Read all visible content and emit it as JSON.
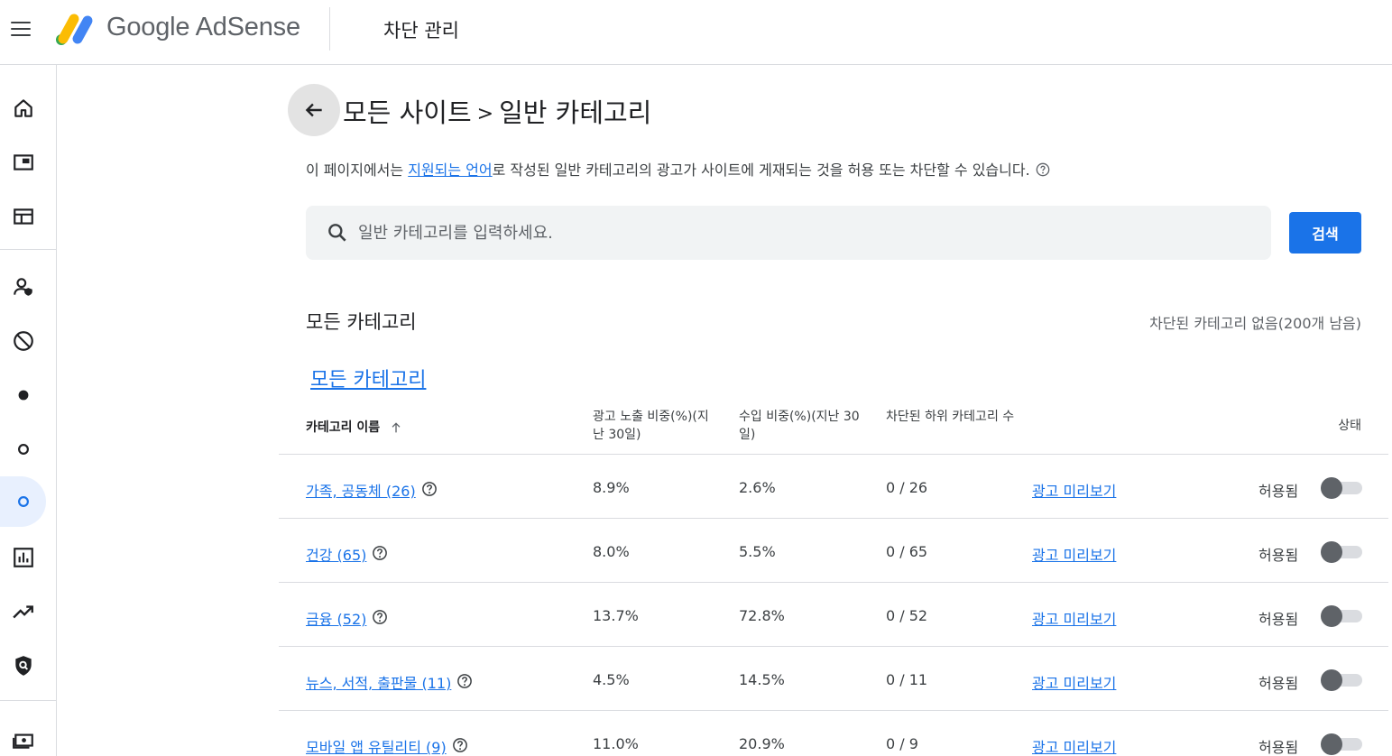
{
  "app": {
    "brand": "Google AdSense",
    "section": "차단 관리"
  },
  "page": {
    "breadcrumb_root": "모든 사이트",
    "breadcrumb_sep": ">",
    "breadcrumb_current": "일반 카테고리",
    "desc_pre": "이 페이지에서는 ",
    "desc_link": "지원되는 언어",
    "desc_post": "로 작성된 일반 카테고리의 광고가 사이트에 게재되는 것을 허용 또는 차단할 수 있습니다."
  },
  "search": {
    "placeholder": "일반 카테고리를 입력하세요.",
    "button": "검색"
  },
  "section": {
    "title": "모든 카테고리",
    "status": "차단된 카테고리 없음(200개 남음)",
    "link": "모든 카테고리"
  },
  "table": {
    "headers": {
      "name": "카테고리 이름",
      "impressions": "광고 노출 비중(%)(지난 30일)",
      "revenue": "수입 비중(%)(지난 30일)",
      "blocked": "차단된 하위 카테고리 수",
      "status": "상태"
    },
    "rows": [
      {
        "name": "가족, 공동체 (26)",
        "impressions": "8.9%",
        "revenue": "2.6%",
        "blocked": "0 / 26",
        "preview": "광고 미리보기",
        "status": "허용됨"
      },
      {
        "name": "건강 (65)",
        "impressions": "8.0%",
        "revenue": "5.5%",
        "blocked": "0 / 65",
        "preview": "광고 미리보기",
        "status": "허용됨"
      },
      {
        "name": "금융 (52)",
        "impressions": "13.7%",
        "revenue": "72.8%",
        "blocked": "0 / 52",
        "preview": "광고 미리보기",
        "status": "허용됨"
      },
      {
        "name": "뉴스, 서적, 출판물 (11)",
        "impressions": "4.5%",
        "revenue": "14.5%",
        "blocked": "0 / 11",
        "preview": "광고 미리보기",
        "status": "허용됨"
      },
      {
        "name": "모바일 앱 유틸리티 (9)",
        "impressions": "11.0%",
        "revenue": "20.9%",
        "blocked": "0 / 9",
        "preview": "광고 미리보기",
        "status": "허용됨"
      }
    ]
  },
  "sidebar": {
    "icons": [
      "home-icon",
      "ad-unit-icon",
      "sites-icon",
      "privacy-icon",
      "block-icon",
      "dot-filled-icon",
      "dot-outline-icon",
      "dot-outline-active-icon",
      "reports-icon",
      "optimization-icon",
      "policy-icon",
      "payments-icon"
    ]
  },
  "colors": {
    "accent": "#1a73e8",
    "active_nav": "#e8f0fe",
    "toggle_off": "#5f6368"
  }
}
